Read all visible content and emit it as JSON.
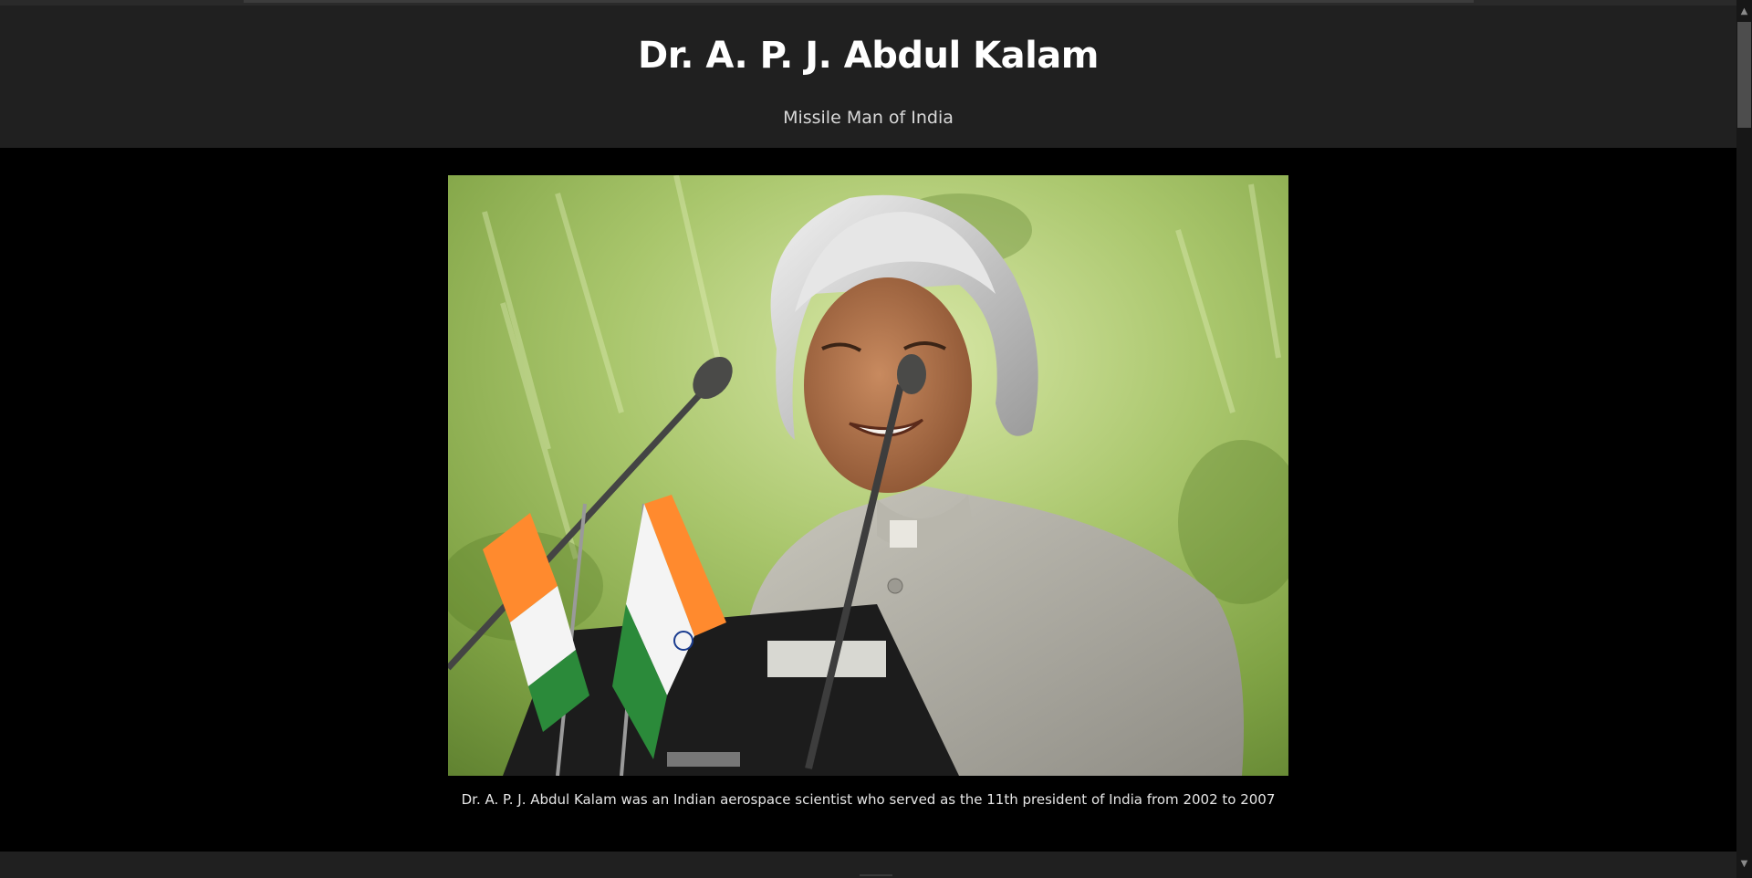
{
  "page": {
    "title": "Dr. A. P. J. Abdul Kalam",
    "subtitle": "Missile Man of India"
  },
  "figure": {
    "image_name": "kalam-speaking-portrait",
    "caption": "Dr. A. P. J. Abdul Kalam was an Indian aerospace scientist who served as the 11th president of India from 2002 to 2007"
  },
  "scrollbar": {
    "up_icon": "chevron-up-icon",
    "down_icon": "chevron-down-icon",
    "up_glyph": "▲",
    "down_glyph": "▼"
  },
  "colors": {
    "header_bg": "#202020",
    "page_bg": "#000000",
    "title": "#ffffff",
    "subtitle": "#d8d8d8",
    "caption": "#e6e6e6"
  }
}
